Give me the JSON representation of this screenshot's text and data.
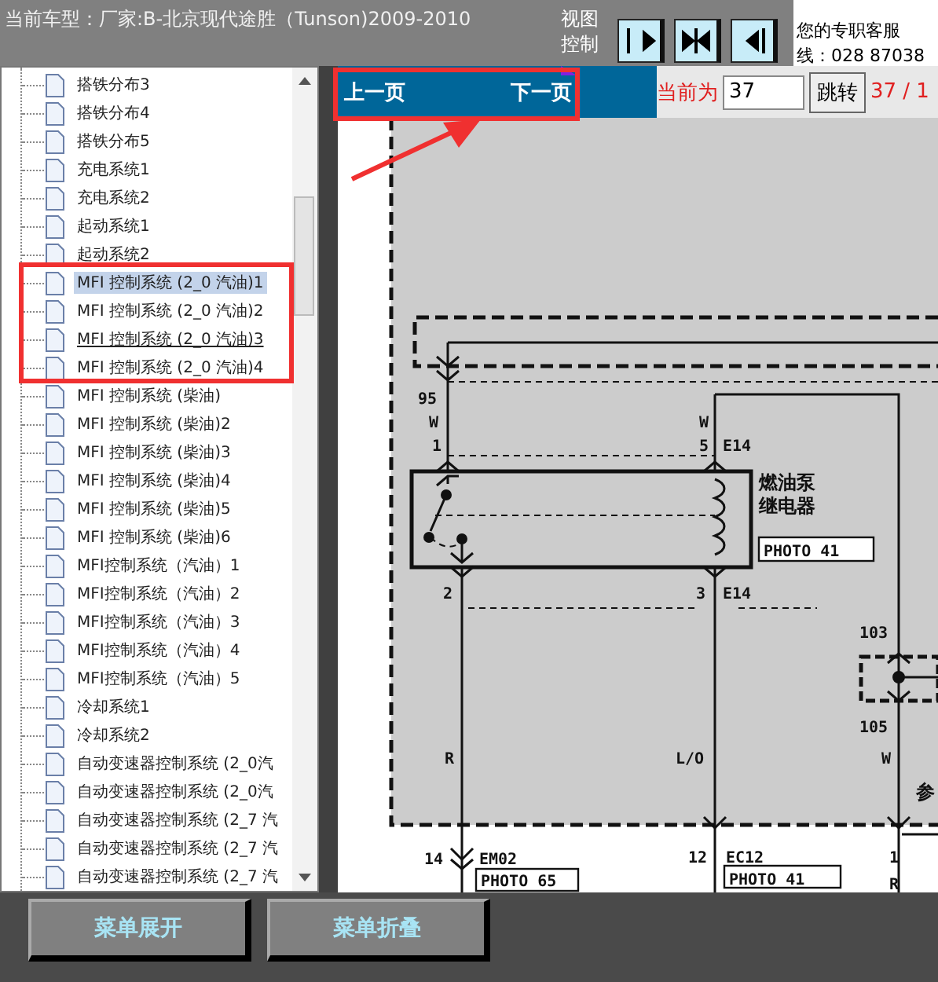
{
  "header": {
    "title": "当前车型：厂家:B-北京现代途胜（Tunson)2009-2010",
    "view_control": "视图控制",
    "view_buttons": [
      {
        "kind": "right"
      },
      {
        "kind": "both"
      },
      {
        "kind": "left"
      }
    ],
    "service": [
      "您的专职客服",
      "线：028 87038"
    ]
  },
  "tree": {
    "items": [
      {
        "label": "搭铁分布3",
        "selected": false,
        "hovered": false
      },
      {
        "label": "搭铁分布4",
        "selected": false,
        "hovered": false
      },
      {
        "label": "搭铁分布5",
        "selected": false,
        "hovered": false
      },
      {
        "label": "充电系统1",
        "selected": false,
        "hovered": false
      },
      {
        "label": "充电系统2",
        "selected": false,
        "hovered": false
      },
      {
        "label": "起动系统1",
        "selected": false,
        "hovered": false
      },
      {
        "label": "起动系统2",
        "selected": false,
        "hovered": false
      },
      {
        "label": "MFI 控制系统 (2_0 汽油)1",
        "selected": true,
        "hovered": false
      },
      {
        "label": "MFI 控制系统 (2_0 汽油)2",
        "selected": false,
        "hovered": false
      },
      {
        "label": "MFI 控制系统 (2_0 汽油)3",
        "selected": false,
        "hovered": true
      },
      {
        "label": "MFI 控制系统 (2_0 汽油)4",
        "selected": false,
        "hovered": false
      },
      {
        "label": "MFI 控制系统 (柴油)",
        "selected": false,
        "hovered": false
      },
      {
        "label": "MFI 控制系统 (柴油)2",
        "selected": false,
        "hovered": false
      },
      {
        "label": "MFI 控制系统 (柴油)3",
        "selected": false,
        "hovered": false
      },
      {
        "label": "MFI 控制系统 (柴油)4",
        "selected": false,
        "hovered": false
      },
      {
        "label": "MFI 控制系统 (柴油)5",
        "selected": false,
        "hovered": false
      },
      {
        "label": "MFI 控制系统 (柴油)6",
        "selected": false,
        "hovered": false
      },
      {
        "label": "MFI控制系统（汽油）1",
        "selected": false,
        "hovered": false
      },
      {
        "label": "MFI控制系统（汽油）2",
        "selected": false,
        "hovered": false
      },
      {
        "label": "MFI控制系统（汽油）3",
        "selected": false,
        "hovered": false
      },
      {
        "label": "MFI控制系统（汽油）4",
        "selected": false,
        "hovered": false
      },
      {
        "label": "MFI控制系统（汽油）5",
        "selected": false,
        "hovered": false
      },
      {
        "label": "冷却系统1",
        "selected": false,
        "hovered": false
      },
      {
        "label": "冷却系统2",
        "selected": false,
        "hovered": false
      },
      {
        "label": "自动变速器控制系统 (2_0汽",
        "selected": false,
        "hovered": false
      },
      {
        "label": "自动变速器控制系统 (2_0汽",
        "selected": false,
        "hovered": false
      },
      {
        "label": "自动变速器控制系统 (2_7 汽",
        "selected": false,
        "hovered": false
      },
      {
        "label": "自动变速器控制系统 (2_7 汽",
        "selected": false,
        "hovered": false
      },
      {
        "label": "自动变速器控制系统 (2_7 汽",
        "selected": false,
        "hovered": false
      }
    ]
  },
  "pager": {
    "prev": "上一页",
    "next": "下一页",
    "current_label": "当前为",
    "page_value": "37",
    "jump": "跳转",
    "page_count": "37 / 1"
  },
  "diagram": {
    "labels": [
      "95",
      "W",
      "1",
      "W",
      "5",
      "E14",
      "燃油泵",
      "继电器",
      "PHOTO 41",
      "2",
      "3",
      "E14",
      "103",
      "105",
      "R",
      "L/O",
      "W",
      "参",
      "14",
      "EM02",
      "PHOTO 65",
      "12",
      "EC12",
      "PHOTO 41",
      "1",
      "R"
    ]
  },
  "footer": {
    "buttons": [
      "菜单展开",
      "菜单折叠"
    ]
  }
}
